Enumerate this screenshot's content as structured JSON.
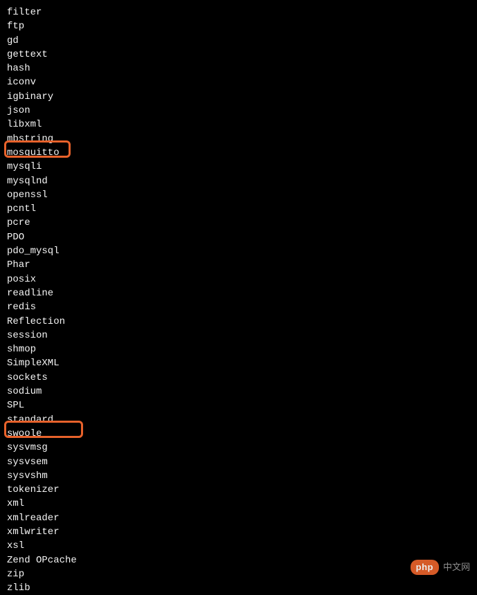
{
  "modules": [
    "filter",
    "ftp",
    "gd",
    "gettext",
    "hash",
    "iconv",
    "igbinary",
    "json",
    "libxml",
    "mbstring",
    "mosquitto",
    "mysqli",
    "mysqlnd",
    "openssl",
    "pcntl",
    "pcre",
    "PDO",
    "pdo_mysql",
    "Phar",
    "posix",
    "readline",
    "redis",
    "Reflection",
    "session",
    "shmop",
    "SimpleXML",
    "sockets",
    "sodium",
    "SPL",
    "standard",
    "swoole",
    "sysvmsg",
    "sysvsem",
    "sysvshm",
    "tokenizer",
    "xml",
    "xmlreader",
    "xmlwriter",
    "xsl",
    "Zend OPcache",
    "zip",
    "zlib"
  ],
  "highlighted": [
    "mosquitto",
    "swoole"
  ],
  "watermark": {
    "badge": "php",
    "text": "中文网"
  }
}
